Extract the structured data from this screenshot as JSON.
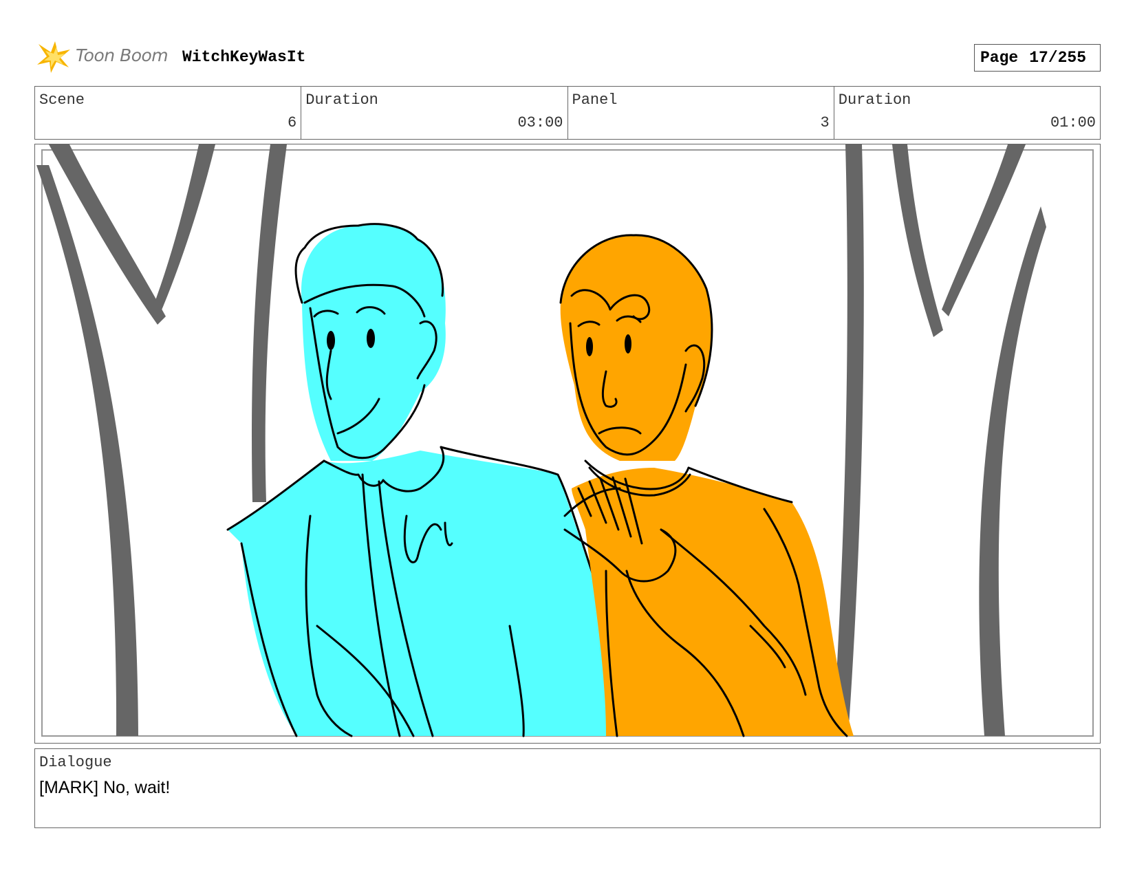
{
  "header": {
    "brand": "Toon Boom",
    "project_title": "WitchKeyWasIt",
    "page_label": "Page",
    "page_number": "17/255"
  },
  "info": {
    "scene_label": "Scene",
    "scene_value": "6",
    "scene_duration_label": "Duration",
    "scene_duration_value": "03:00",
    "panel_label": "Panel",
    "panel_value": "3",
    "panel_duration_label": "Duration",
    "panel_duration_value": "01:00"
  },
  "panel": {
    "colors": {
      "left_character": "#55ffff",
      "right_character": "#ffa500",
      "trees": "#666666",
      "lines": "#000000"
    }
  },
  "dialogue": {
    "label": "Dialogue",
    "text": "[MARK] No, wait!"
  }
}
